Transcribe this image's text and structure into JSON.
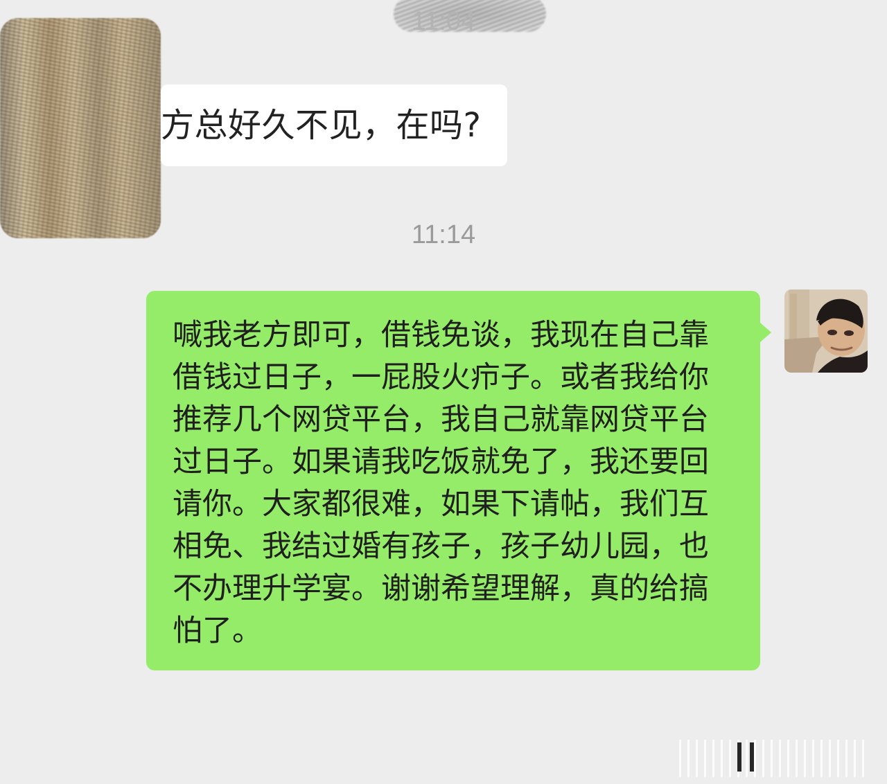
{
  "messages": {
    "time_top": "11:04",
    "incoming": {
      "text": "方总好久不见，在吗?"
    },
    "time_middle": "11:14",
    "outgoing": {
      "text": "喊我老方即可，借钱免谈，我现在自己靠借钱过日子，一屁股火疖子。或者我给你推荐几个网贷平台，我自己就靠网贷平台过日子。如果请我吃饭就免了，我还要回请你。大家都很难，如果下请帖，我们互相免、我结过婚有孩子，孩子幼儿园，也不办理升学宴。谢谢希望理解，真的给搞怕了。"
    }
  },
  "colors": {
    "background": "#ededed",
    "incoming_bubble": "#ffffff",
    "outgoing_bubble": "#95ec69",
    "timestamp": "#9a9a9a"
  }
}
